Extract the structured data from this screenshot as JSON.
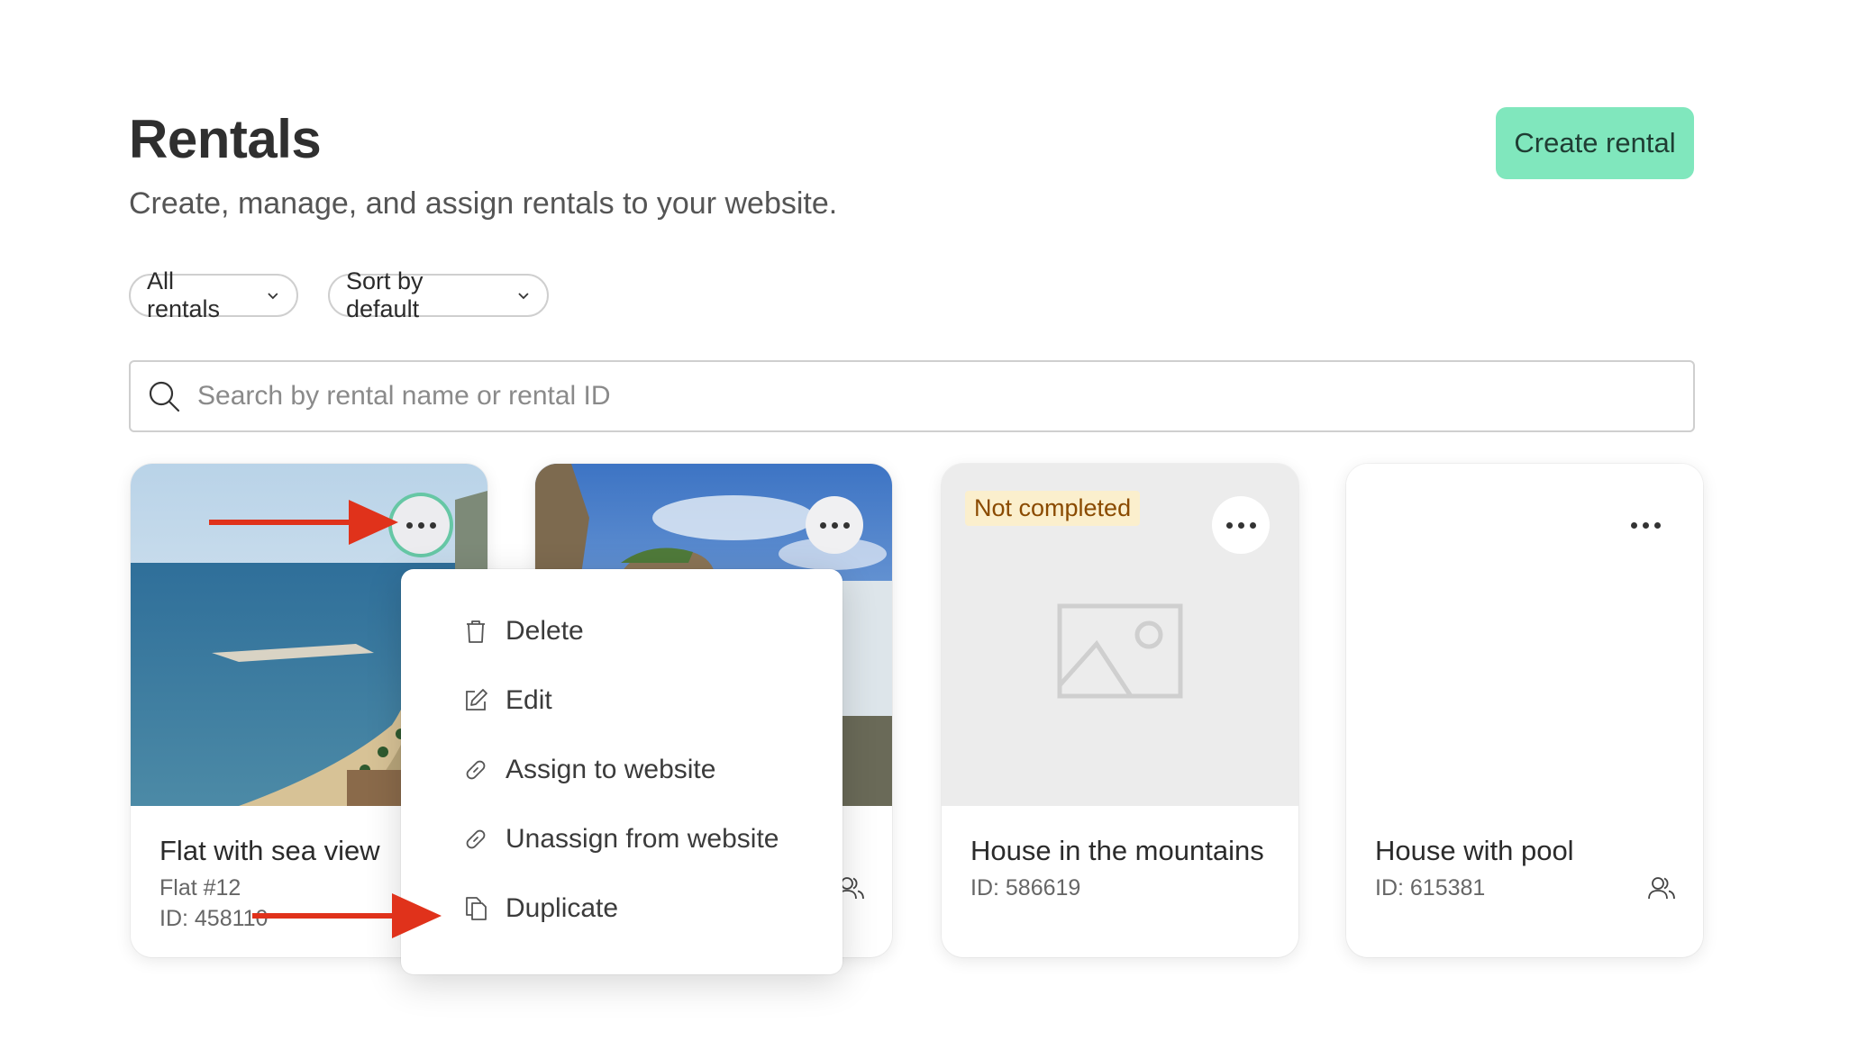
{
  "header": {
    "title": "Rentals",
    "subtitle": "Create, manage, and assign rentals to your website.",
    "create_button": "Create rental"
  },
  "filters": {
    "all_rentals": "All rentals",
    "sort": "Sort by default"
  },
  "search": {
    "placeholder": "Search by rental name or rental ID"
  },
  "cards": [
    {
      "name": "Flat with sea view",
      "line1": "Flat #12",
      "line2": "ID: 458110"
    },
    {
      "name": "",
      "line1": "",
      "line2": ""
    },
    {
      "name": "House in the mountains",
      "line1": "ID: 586619",
      "line2": "",
      "badge": "Not completed"
    },
    {
      "name": "House with pool",
      "line1": "ID: 615381",
      "line2": ""
    }
  ],
  "context_menu": {
    "items": [
      "Delete",
      "Edit",
      "Assign to website",
      "Unassign from website",
      "Duplicate"
    ]
  },
  "colors": {
    "accent": "#80e7bd",
    "annotation_arrow": "#e0321b",
    "badge_bg": "#fbefcd"
  }
}
